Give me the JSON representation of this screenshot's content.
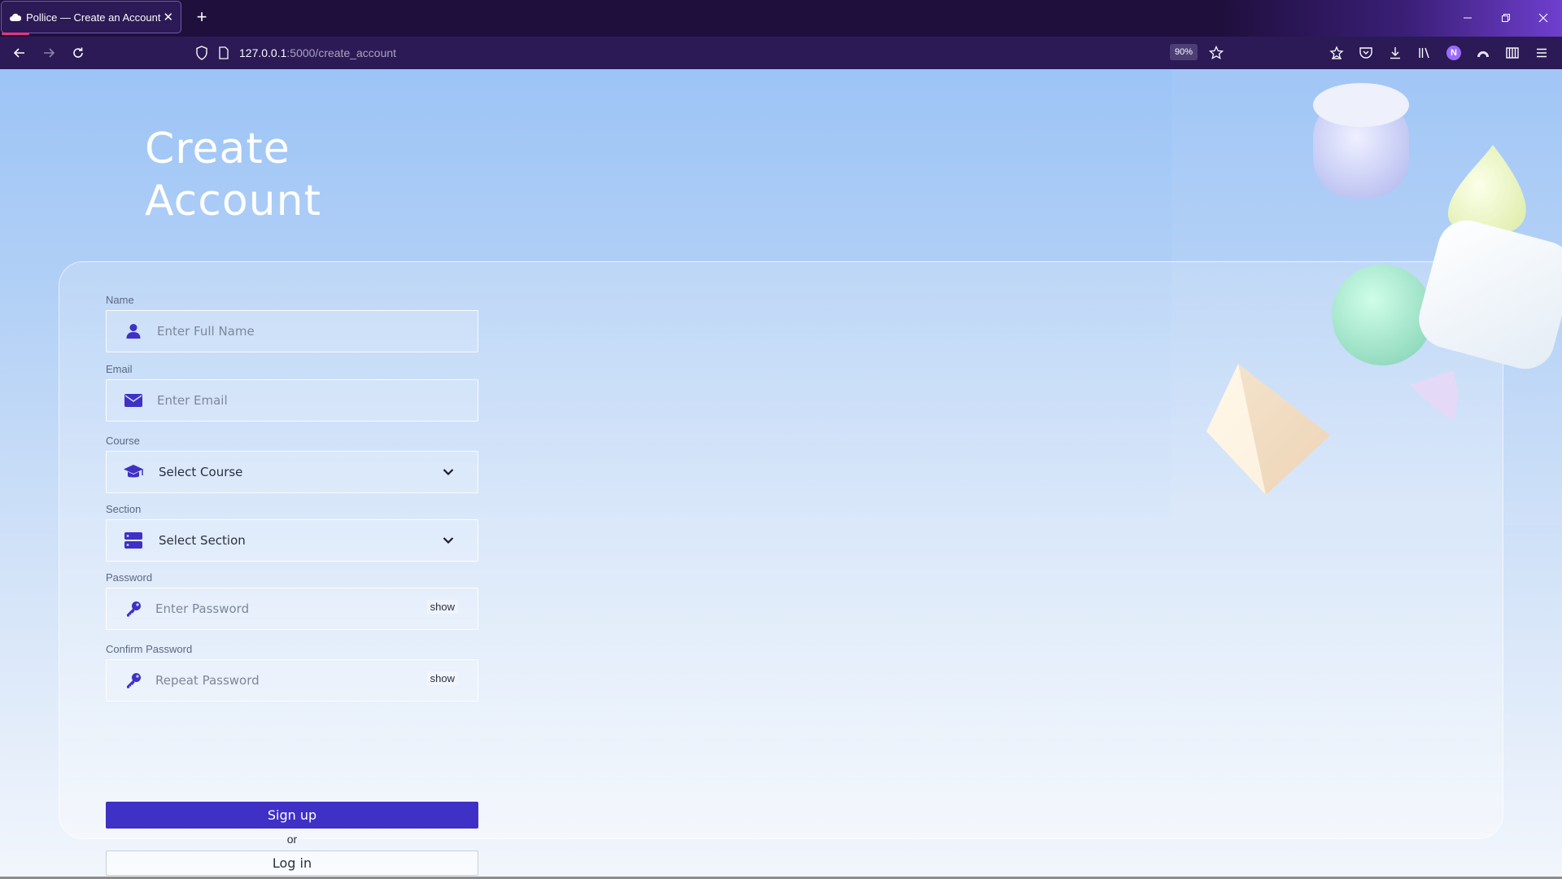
{
  "browser": {
    "tab_title": "Pollice — Create an Account",
    "tab_close": "✕",
    "new_tab": "+",
    "url_host": "127.0.0.1",
    "url_path": ":5000/create_account",
    "zoom": "90%",
    "profile_initial": "N"
  },
  "page": {
    "title_line1": "Create",
    "title_line2": "Account"
  },
  "form": {
    "name": {
      "label": "Name",
      "placeholder": "Enter Full Name"
    },
    "email": {
      "label": "Email",
      "placeholder": "Enter Email"
    },
    "course": {
      "label": "Course",
      "selected": "Select Course"
    },
    "section": {
      "label": "Section",
      "selected": "Select Section"
    },
    "password": {
      "label": "Password",
      "placeholder": "Enter Password",
      "toggle": "show"
    },
    "confirm_password": {
      "label": "Confirm Password",
      "placeholder": "Repeat Password",
      "toggle": "show"
    },
    "signup_label": "Sign up",
    "or_text": "or",
    "login_label": "Log in"
  },
  "colors": {
    "accent": "#3f30c6",
    "browser_bg": "#1f0f3d",
    "toolbar_bg": "#2b1a55"
  }
}
